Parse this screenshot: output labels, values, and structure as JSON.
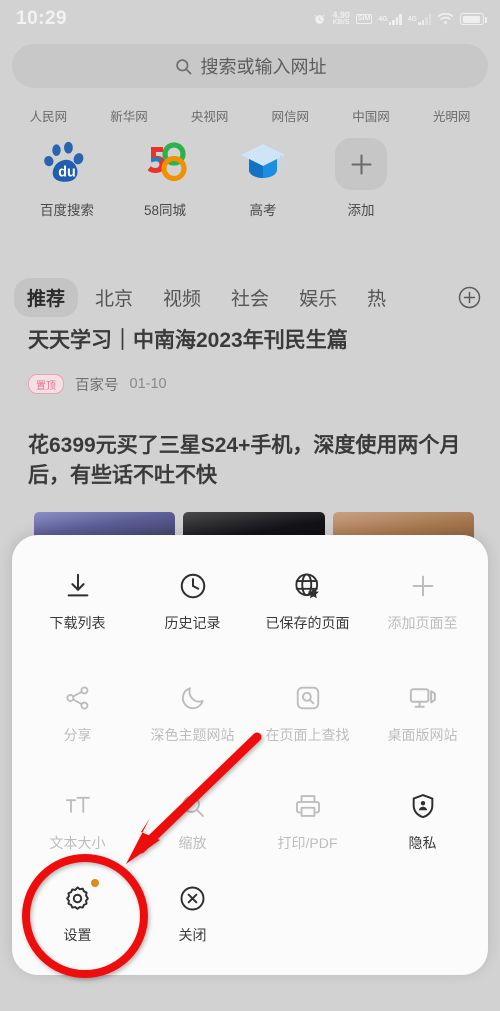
{
  "statusbar": {
    "time": "10:29",
    "alarm_icon": "alarm-icon",
    "net_speed_value": "4.90",
    "net_speed_unit": "KB/S",
    "sim_label": "SIM",
    "signal1_label": "4G",
    "signal2_label": "4G",
    "wifi_icon": "wifi-icon",
    "battery_icon": "battery-icon"
  },
  "search": {
    "icon": "search-icon",
    "placeholder": "搜索或输入网址"
  },
  "quicklinks": [
    {
      "label": "人民网"
    },
    {
      "label": "新华网"
    },
    {
      "label": "央视网"
    },
    {
      "label": "网信网"
    },
    {
      "label": "中国网"
    },
    {
      "label": "光明网"
    }
  ],
  "shortcuts": [
    {
      "label": "百度搜索",
      "icon": "baidu-paw-icon"
    },
    {
      "label": "58同城",
      "icon": "58tongcheng-icon"
    },
    {
      "label": "高考",
      "icon": "graduation-cap-icon"
    },
    {
      "label": "添加",
      "icon": "plus-icon"
    }
  ],
  "tabs": {
    "items": [
      {
        "label": "推荐",
        "active": true
      },
      {
        "label": "北京",
        "active": false
      },
      {
        "label": "视频",
        "active": false
      },
      {
        "label": "社会",
        "active": false
      },
      {
        "label": "娱乐",
        "active": false
      },
      {
        "label": "热",
        "active": false
      }
    ],
    "add_icon": "circle-plus-icon"
  },
  "feed": {
    "article1": {
      "title": "天天学习｜中南海2023年刊民生篇",
      "badge": "置顶",
      "source": "百家号",
      "date": "01-10"
    },
    "article2": {
      "title": "花6399元买了三星S24+手机，深度使用两个月后，有些话不吐不快"
    }
  },
  "sheet": {
    "rows": [
      [
        {
          "label": "下载列表",
          "icon": "download-icon",
          "disabled": false
        },
        {
          "label": "历史记录",
          "icon": "clock-icon",
          "disabled": false
        },
        {
          "label": "已保存的页面",
          "icon": "globe-star-icon",
          "disabled": false
        },
        {
          "label": "添加页面至",
          "icon": "plus-icon",
          "disabled": true
        }
      ],
      [
        {
          "label": "分享",
          "icon": "share-icon",
          "disabled": true
        },
        {
          "label": "深色主题网站",
          "icon": "moon-icon",
          "disabled": true
        },
        {
          "label": "在页面上查找",
          "icon": "find-in-page-icon",
          "disabled": true
        },
        {
          "label": "桌面版网站",
          "icon": "desktop-icon",
          "disabled": true
        }
      ],
      [
        {
          "label": "文本大小",
          "icon": "text-size-icon",
          "disabled": true
        },
        {
          "label": "缩放",
          "icon": "zoom-icon",
          "disabled": true
        },
        {
          "label": "打印/PDF",
          "icon": "printer-icon",
          "disabled": true
        },
        {
          "label": "隐私",
          "icon": "privacy-shield-icon",
          "disabled": false
        }
      ],
      [
        {
          "label": "设置",
          "icon": "gear-icon",
          "disabled": false,
          "badge_dot": true
        },
        {
          "label": "关闭",
          "icon": "close-circle-icon",
          "disabled": false
        }
      ]
    ]
  },
  "annotations": {
    "highlight_color": "#ee1111",
    "circle_target": "设置",
    "arrow": "arrow-pointing-to-settings"
  }
}
